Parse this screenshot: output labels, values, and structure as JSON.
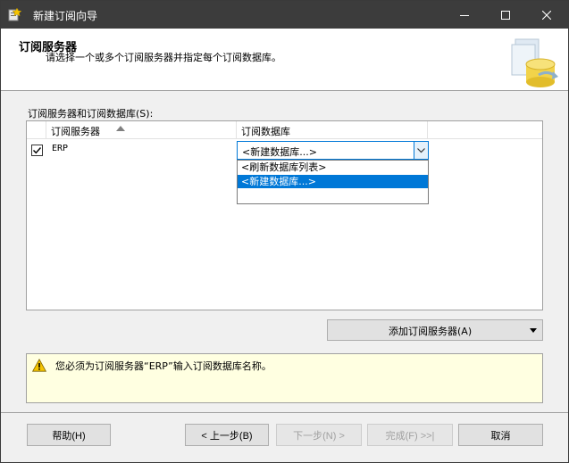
{
  "window": {
    "title": "新建订阅向导"
  },
  "header": {
    "title": "订阅服务器",
    "subtitle": "请选择一个或多个订阅服务器并指定每个订阅数据库。"
  },
  "grid": {
    "label": "订阅服务器和订阅数据库(S):",
    "columns": [
      "订阅服务器",
      "订阅数据库"
    ],
    "rows": [
      {
        "checked": true,
        "subscriber": "ERP",
        "database": "<新建数据库...>"
      }
    ]
  },
  "dropdown": {
    "options": [
      "<刷新数据库列表>",
      "<新建数据库...>"
    ],
    "selected_index": 1
  },
  "add_button": {
    "label": "添加订阅服务器(A)"
  },
  "message": {
    "text": "您必须为订阅服务器“ERP”输入订阅数据库名称。"
  },
  "buttons": {
    "help": "帮助(H)",
    "back": "< 上一步(B)",
    "next": "下一步(N) >",
    "finish": "完成(F) >>|",
    "cancel": "取消"
  },
  "colors": {
    "accent": "#0078d7",
    "titlebar": "#3c3c3c",
    "message_bg": "#ffffe1",
    "warning": "#f5c400"
  }
}
